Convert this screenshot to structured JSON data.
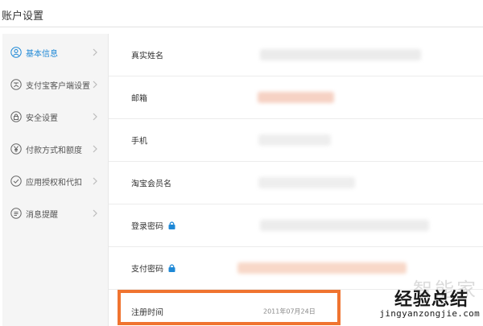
{
  "page": {
    "title": "账户设置"
  },
  "sidebar": {
    "items": [
      {
        "label": "基本信息",
        "icon": "user-icon",
        "active": true
      },
      {
        "label": "支付宝客户端设置",
        "icon": "alipay-client-icon",
        "active": false
      },
      {
        "label": "安全设置",
        "icon": "lock-icon",
        "active": false
      },
      {
        "label": "付款方式和额度",
        "icon": "yuan-icon",
        "active": false
      },
      {
        "label": "应用授权和代扣",
        "icon": "check-circle-icon",
        "active": false
      },
      {
        "label": "消息提醒",
        "icon": "message-icon",
        "active": false
      }
    ]
  },
  "info": {
    "rows": [
      {
        "label": "真实姓名",
        "value_hidden": true
      },
      {
        "label": "邮箱",
        "value_hidden": true
      },
      {
        "label": "手机",
        "value_hidden": true
      },
      {
        "label": "淘宝会员名",
        "value_hidden": true
      },
      {
        "label": "登录密码",
        "value_hidden": true,
        "lock": true
      },
      {
        "label": "支付密码",
        "value_hidden": true,
        "lock": true
      },
      {
        "label": "注册时间",
        "value": "2011年07月24日"
      }
    ]
  },
  "highlight": {
    "color": "#f07430",
    "target": "注册时间"
  },
  "watermark": {
    "main": "经验总结",
    "back": "智能家",
    "url": "jingyanzongjie.com"
  },
  "colors": {
    "accent": "#1e88d6",
    "sidebar_bg": "#f5f5f5",
    "highlight": "#f07430"
  }
}
